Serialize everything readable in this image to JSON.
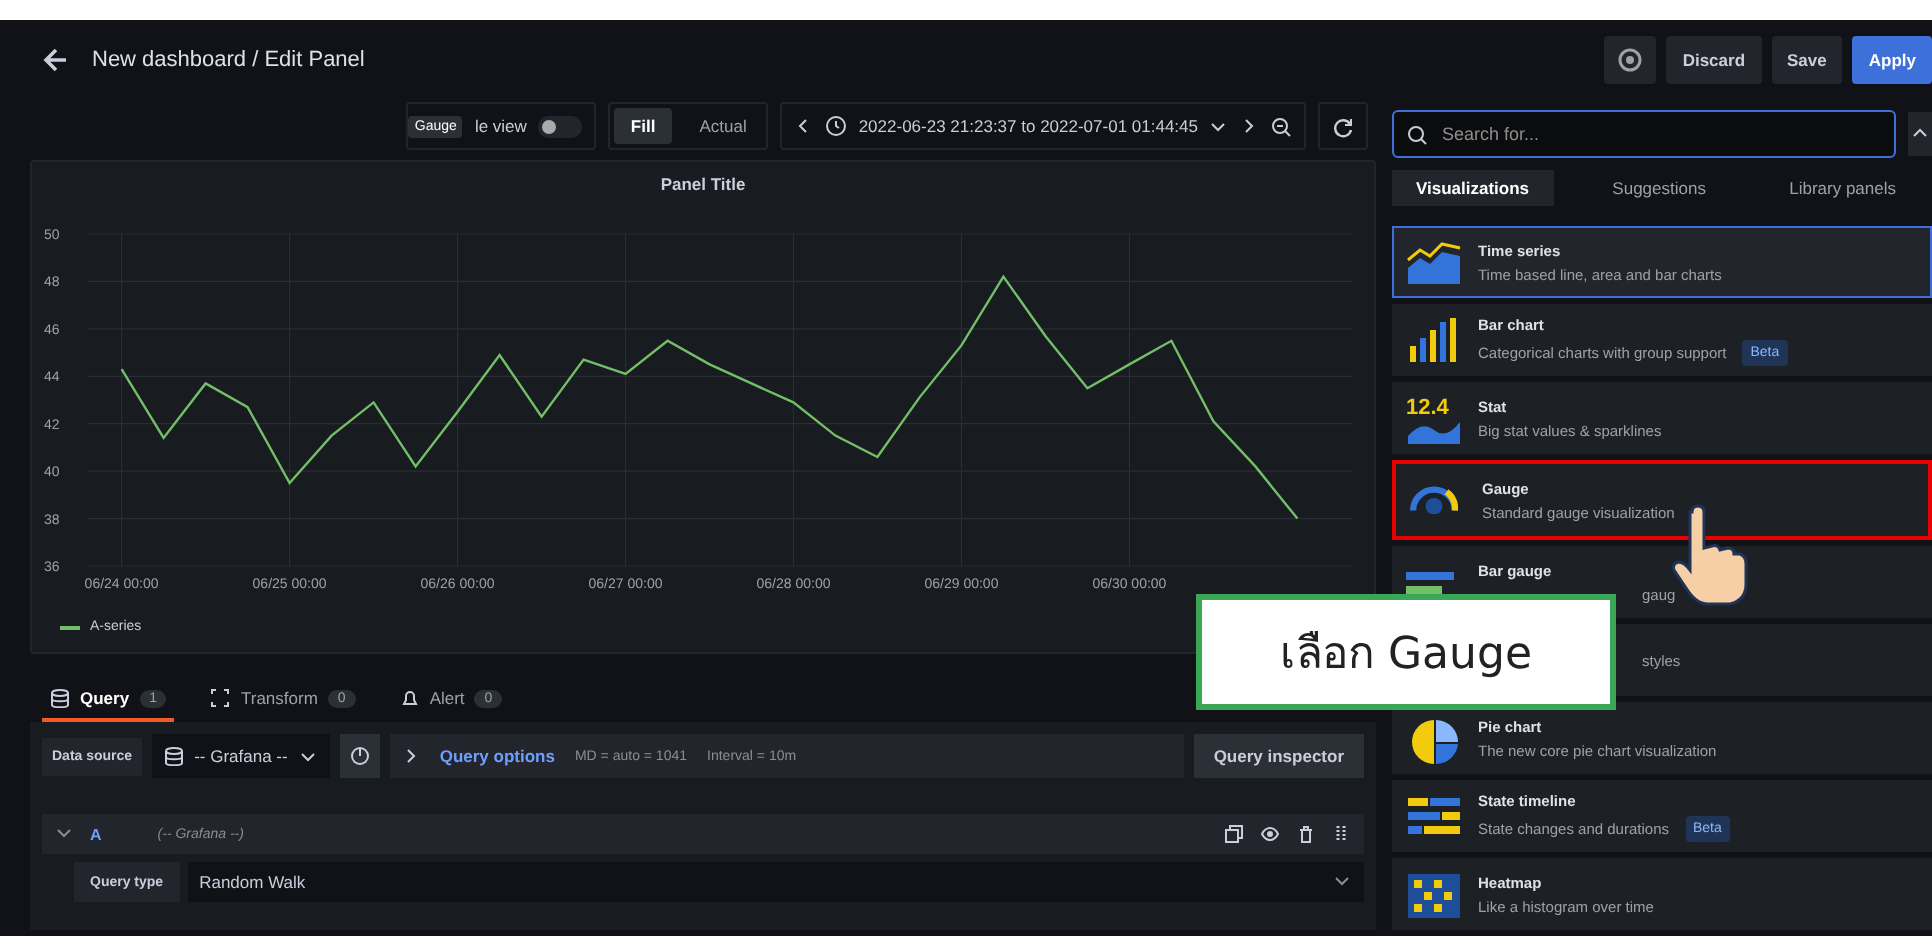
{
  "header": {
    "title": "New dashboard / Edit Panel",
    "buttons": [
      {
        "label": "Discard",
        "kind": "secondary"
      },
      {
        "label": "Save",
        "kind": "secondary"
      },
      {
        "label": "Apply",
        "kind": "primary"
      }
    ]
  },
  "toolbar": {
    "tooltip": "Gauge",
    "table_view": {
      "label": "le view",
      "on": false
    },
    "fit_modes": [
      {
        "label": "Fill",
        "selected": true
      },
      {
        "label": "Actual",
        "selected": false
      }
    ],
    "time_range": "2022-06-23 21:23:37 to 2022-07-01 01:44:45"
  },
  "panel": {
    "title": "Panel Title",
    "chart_data": {
      "type": "line",
      "grid": true,
      "categories": [
        "06/24 00:00",
        null,
        null,
        null,
        "06/25 00:00",
        null,
        null,
        null,
        "06/26 00:00",
        null,
        null,
        null,
        "06/27 00:00",
        null,
        null,
        null,
        "06/28 00:00",
        null,
        null,
        null,
        "06/29 00:00",
        null,
        null,
        null,
        "06/30 00:00",
        null,
        null,
        null,
        null
      ],
      "series": [
        {
          "name": "A-series",
          "color": "#73bf69",
          "values": [
            44.3,
            41.4,
            43.7,
            42.7,
            39.5,
            41.5,
            42.9,
            40.2,
            42.5,
            44.9,
            42.3,
            44.7,
            44.1,
            45.5,
            44.5,
            43.7,
            42.9,
            41.5,
            40.6,
            43.1,
            45.3,
            48.2,
            45.7,
            43.5,
            44.5,
            45.5,
            42.1,
            40.2,
            38.0
          ]
        }
      ],
      "ylim": [
        36,
        50
      ],
      "yticks": [
        36,
        38,
        40,
        42,
        44,
        46,
        48,
        50
      ]
    }
  },
  "query_tabs": [
    {
      "label": "Query",
      "count": "1",
      "selected": true
    },
    {
      "label": "Transform",
      "count": "0",
      "selected": false
    },
    {
      "label": "Alert",
      "count": "0",
      "selected": false
    }
  ],
  "query_bar": {
    "data_source_label": "Data source",
    "data_source": "-- Grafana --",
    "options_label": "Query options",
    "options_info": [
      "MD = auto = 1041",
      "Interval = 10m"
    ],
    "inspector": "Query inspector"
  },
  "query": {
    "ref": "A",
    "source": "(-- Grafana --)",
    "expanded": true,
    "fields": [
      {
        "label": "Query type",
        "value": "Random Walk"
      }
    ]
  },
  "viz_picker": {
    "search_placeholder": "Search for...",
    "tabs": [
      {
        "label": "Visualizations",
        "selected": true
      },
      {
        "label": "Suggestions",
        "selected": false
      },
      {
        "label": "Library panels",
        "selected": false
      }
    ],
    "items": [
      {
        "kind": "timeseries",
        "name": "Time series",
        "description": "Time based line, area and bar charts",
        "selected": true,
        "highlighted": false,
        "covered": false
      },
      {
        "kind": "barchart",
        "name": "Bar chart",
        "description": "Categorical charts with group support",
        "badge": "Beta",
        "selected": false,
        "highlighted": false,
        "covered": false
      },
      {
        "kind": "stat",
        "icon_text": "12.4",
        "name": "Stat",
        "description": "Big stat values & sparklines",
        "selected": false,
        "highlighted": false,
        "covered": false
      },
      {
        "kind": "gauge",
        "name": "Gauge",
        "description": "Standard gauge visualization",
        "selected": false,
        "highlighted": true,
        "covered": false
      },
      {
        "kind": "bargauge",
        "name": "Bar gauge",
        "description": "gaug",
        "selected": false,
        "highlighted": false,
        "covered": true
      },
      {
        "kind": "table",
        "description": "styles",
        "selected": false,
        "highlighted": false,
        "covered": true
      },
      {
        "kind": "piechart",
        "name": "Pie chart",
        "description": "The new core pie chart visualization",
        "selected": false,
        "highlighted": false,
        "covered": false
      },
      {
        "kind": "statetimeline",
        "name": "State timeline",
        "description": "State changes and durations",
        "badge": "Beta",
        "selected": false,
        "highlighted": false,
        "covered": false
      },
      {
        "kind": "heatmap",
        "name": "Heatmap",
        "description": "Like a histogram over time",
        "selected": false,
        "highlighted": false,
        "covered": false
      }
    ]
  },
  "annotation": {
    "text": "เลือก Gauge"
  }
}
